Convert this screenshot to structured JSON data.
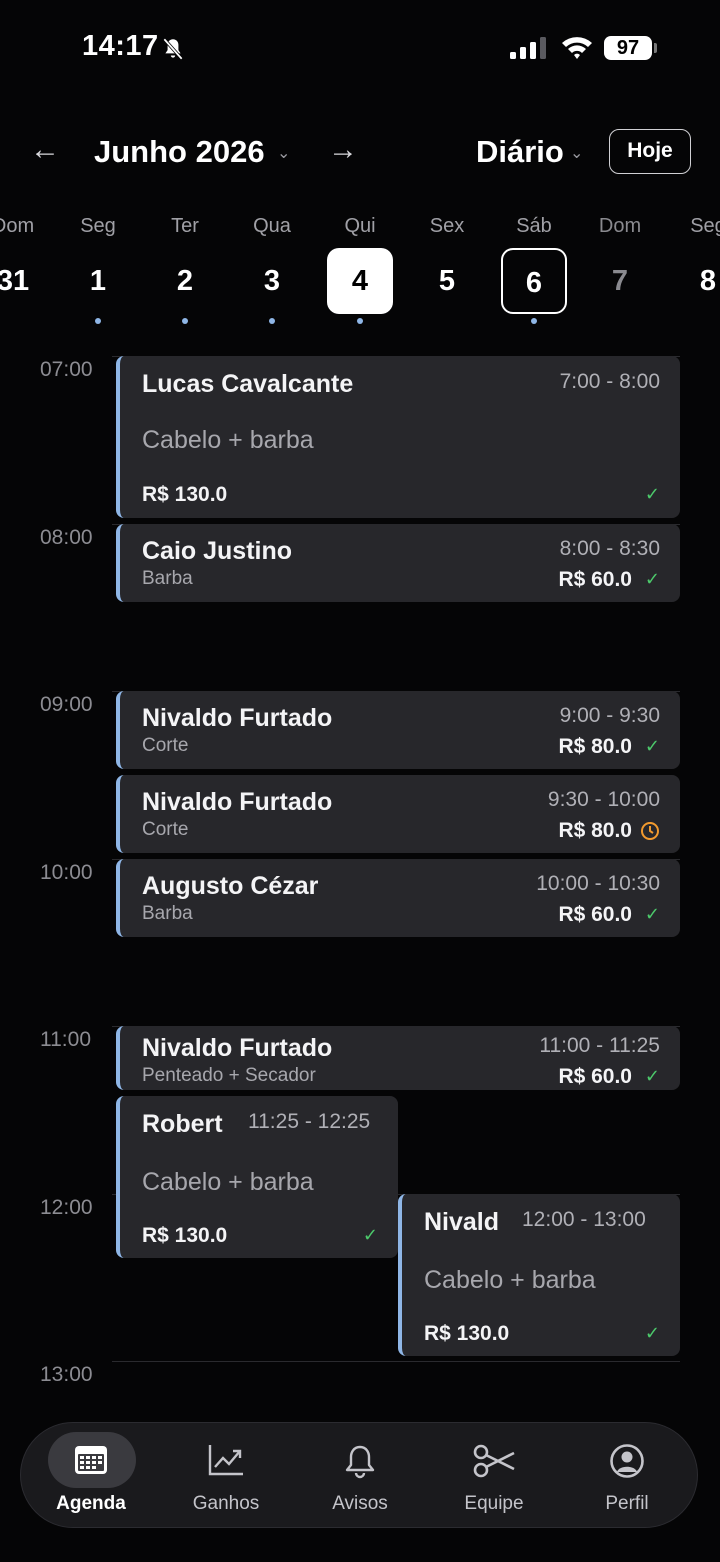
{
  "status_bar": {
    "time": "14:17",
    "battery": "97"
  },
  "header": {
    "month": "Junho 2026",
    "view": "Diário",
    "today": "Hoje"
  },
  "week": [
    {
      "wd": "Dom",
      "num": "31",
      "dim": false,
      "dot": false
    },
    {
      "wd": "Seg",
      "num": "1",
      "dim": false,
      "dot": true
    },
    {
      "wd": "Ter",
      "num": "2",
      "dim": false,
      "dot": true
    },
    {
      "wd": "Qua",
      "num": "3",
      "dim": false,
      "dot": true
    },
    {
      "wd": "Qui",
      "num": "4",
      "selected": true,
      "dot": true
    },
    {
      "wd": "Sex",
      "num": "5",
      "dim": false,
      "dot": false
    },
    {
      "wd": "Sáb",
      "num": "6",
      "today": true,
      "dot": true
    },
    {
      "wd": "Dom",
      "num": "7",
      "dim": true,
      "dot": false
    },
    {
      "wd": "Seg",
      "num": "8",
      "dim": false,
      "dot": false
    }
  ],
  "hours": [
    "07:00",
    "08:00",
    "09:00",
    "10:00",
    "11:00",
    "12:00",
    "13:00"
  ],
  "appointments": [
    {
      "name": "Lucas Cavalcante",
      "service": "Cabelo + barba",
      "time": "7:00 - 8:00",
      "price": "R$ 130.0",
      "status": "done"
    },
    {
      "name": "Caio Justino",
      "service": "Barba",
      "time": "8:00 - 8:30",
      "price": "R$ 60.0",
      "status": "done"
    },
    {
      "name": "Nivaldo Furtado",
      "service": "Corte",
      "time": "9:00 - 9:30",
      "price": "R$ 80.0",
      "status": "done"
    },
    {
      "name": "Nivaldo Furtado",
      "service": "Corte",
      "time": "9:30 - 10:00",
      "price": "R$ 80.0",
      "status": "pending"
    },
    {
      "name": "Augusto Cézar",
      "service": "Barba",
      "time": "10:00 - 10:30",
      "price": "R$ 60.0",
      "status": "done"
    },
    {
      "name": "Nivaldo Furtado",
      "service": "Penteado + Secador",
      "time": "11:00 - 11:25",
      "price": "R$ 60.0",
      "status": "done"
    },
    {
      "name": "Robert",
      "service": "Cabelo + barba",
      "time": "11:25 - 12:25",
      "price": "R$ 130.0",
      "status": "done"
    },
    {
      "name": "Nivald",
      "service": "Cabelo + barba",
      "time": "12:00 - 13:00",
      "price": "R$ 130.0",
      "status": "done"
    }
  ],
  "nav": [
    {
      "label": "Agenda",
      "icon": "calendar-icon",
      "active": true
    },
    {
      "label": "Ganhos",
      "icon": "chart-icon"
    },
    {
      "label": "Avisos",
      "icon": "bell-icon"
    },
    {
      "label": "Equipe",
      "icon": "scissors-icon"
    },
    {
      "label": "Perfil",
      "icon": "profile-icon"
    }
  ],
  "colors": {
    "accent": "#8fb6e6",
    "done": "#4cc96b",
    "pending": "#f29a2e",
    "card": "#27272b",
    "background": "#050506"
  }
}
